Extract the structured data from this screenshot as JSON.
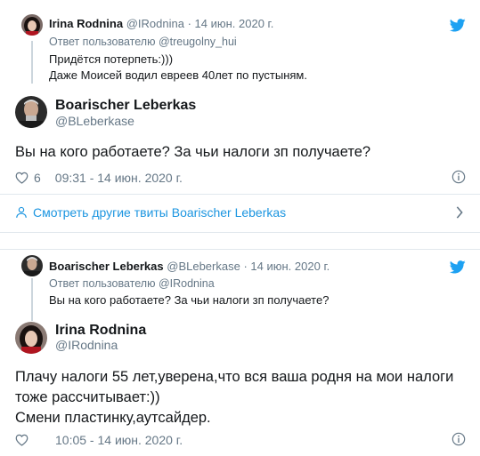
{
  "tweet1": {
    "parent": {
      "name": "Irina Rodnina",
      "handle": "@IRodnina",
      "dot": "·",
      "date": "14 июн. 2020 г.",
      "reply_prefix": "Ответ пользователю",
      "reply_to": "@treugolny_hui",
      "text_line1": "Придётся потерпеть:)))",
      "text_line2": "Даже Моисей водил евреев 40лет по пустыням.",
      "avatar_icon": "irina-avatar"
    },
    "main": {
      "name": "Boarischer Leberkas",
      "handle": "@BLeberkase",
      "text": "Вы на кого работаете? За чьи налоги зп получаете?",
      "likes": "6",
      "time": "09:31 - 14 июн. 2020 г.",
      "avatar_icon": "boarischer-avatar"
    },
    "more_link": "Смотреть другие твиты Boarischer Leberkas"
  },
  "tweet2": {
    "parent": {
      "name": "Boarischer Leberkas",
      "handle": "@BLeberkase",
      "dot": "·",
      "date": "14 июн. 2020 г.",
      "reply_prefix": "Ответ пользователю",
      "reply_to": "@IRodnina",
      "text_line1": "Вы на кого работаете? За чьи налоги зп получаете?",
      "avatar_icon": "boarischer-avatar"
    },
    "main": {
      "name": "Irina Rodnina",
      "handle": "@IRodnina",
      "text_line1": "Плачу налоги 55 лет,уверена,что вся ваша родня на мои налоги",
      "text_line2": "тоже рассчитывает:))",
      "text_line3": "Смени пластинку,аутсайдер.",
      "time": "10:05 - 14 июн. 2020 г.",
      "avatar_icon": "irina-avatar"
    }
  },
  "colors": {
    "link": "#1b95e0",
    "muted": "#657786",
    "text": "#14171a",
    "twitter_bird": "#1da1f2",
    "border": "#e1e8ed"
  }
}
